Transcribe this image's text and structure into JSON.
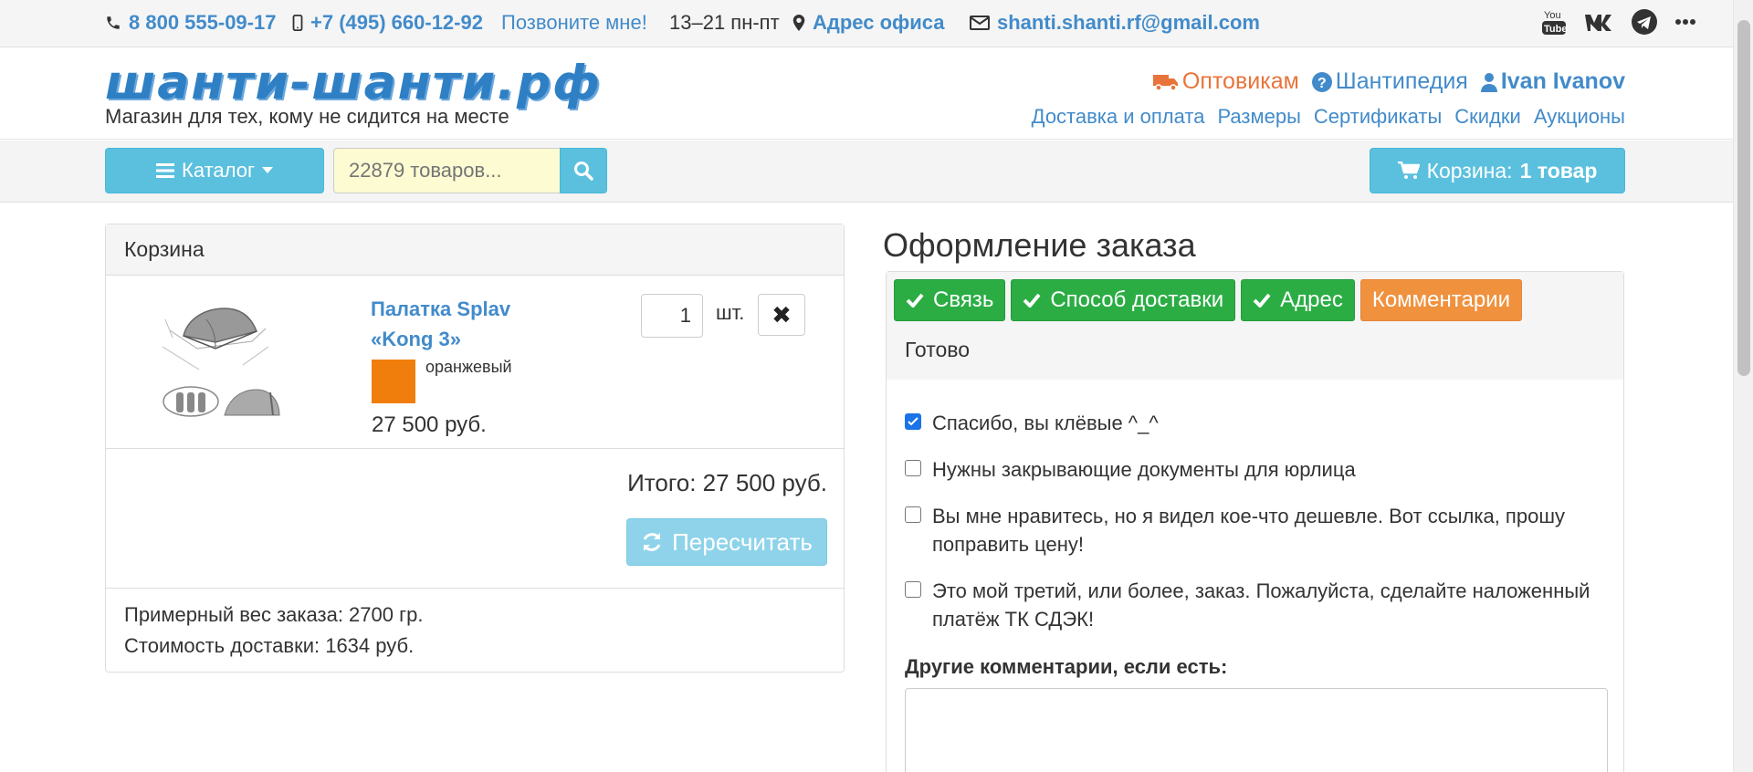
{
  "topbar": {
    "phone1": "8 800 555-09-17",
    "phone2": "+7 (495) 660-12-92",
    "callback": "Позвоните мне!",
    "hours": "13–21 пн-пт",
    "office": "Адрес офиса",
    "email": "shanti.shanti.rf@gmail.com",
    "social": [
      "youtube-icon",
      "vk-icon",
      "telegram-icon",
      "more-icon"
    ]
  },
  "header": {
    "logo": "шанти-шанти.рф",
    "tagline": "Магазин для тех, кому не сидится на месте",
    "wholesale": "Оптовикам",
    "wiki": "Шантипедия",
    "user": "Ivan Ivanov",
    "links": [
      "Доставка и оплата",
      "Размеры",
      "Сертификаты",
      "Скидки",
      "Аукционы"
    ]
  },
  "nav": {
    "catalog": "Каталог",
    "search_placeholder": "22879 товаров...",
    "cart_label": "Корзина:",
    "cart_count": "1 товар"
  },
  "cart": {
    "title": "Корзина",
    "item": {
      "name": "Палатка Splav «Kong 3»",
      "color": "оранжевый",
      "color_hex": "#f07e0d",
      "price": "27 500 руб.",
      "qty": "1",
      "unit": "шт."
    },
    "total": "Итого: 27 500 руб.",
    "recalc": "Пересчитать",
    "weight": "Примерный вес заказа: 2700 гр.",
    "delivery": "Стоимость доставки: 1634 руб."
  },
  "order": {
    "title": "Оформление заказа",
    "steps": [
      {
        "label": "Связь",
        "state": "done"
      },
      {
        "label": "Способ доставки",
        "state": "done"
      },
      {
        "label": "Адрес",
        "state": "done"
      },
      {
        "label": "Комментарии",
        "state": "active"
      }
    ],
    "ready": "Готово",
    "options": [
      {
        "label": "Спасибо, вы клёвые ^_^",
        "checked": true
      },
      {
        "label": "Нужны закрывающие документы для юрлица",
        "checked": false
      },
      {
        "label": "Вы мне нравитесь, но я видел кое-что дешевле. Вот ссылка, прошу поправить цену!",
        "checked": false
      },
      {
        "label": "Это мой третий, или более, заказ. Пожалуйста, сделайте наложенный платёж ТК СДЭК!",
        "checked": false
      }
    ],
    "other_label": "Другие комментарии, если есть:"
  },
  "colors": {
    "link": "#428bca",
    "info": "#5bc0de",
    "success": "#2bad44",
    "warning": "#f0913e",
    "wholesale": "#e8743b"
  }
}
